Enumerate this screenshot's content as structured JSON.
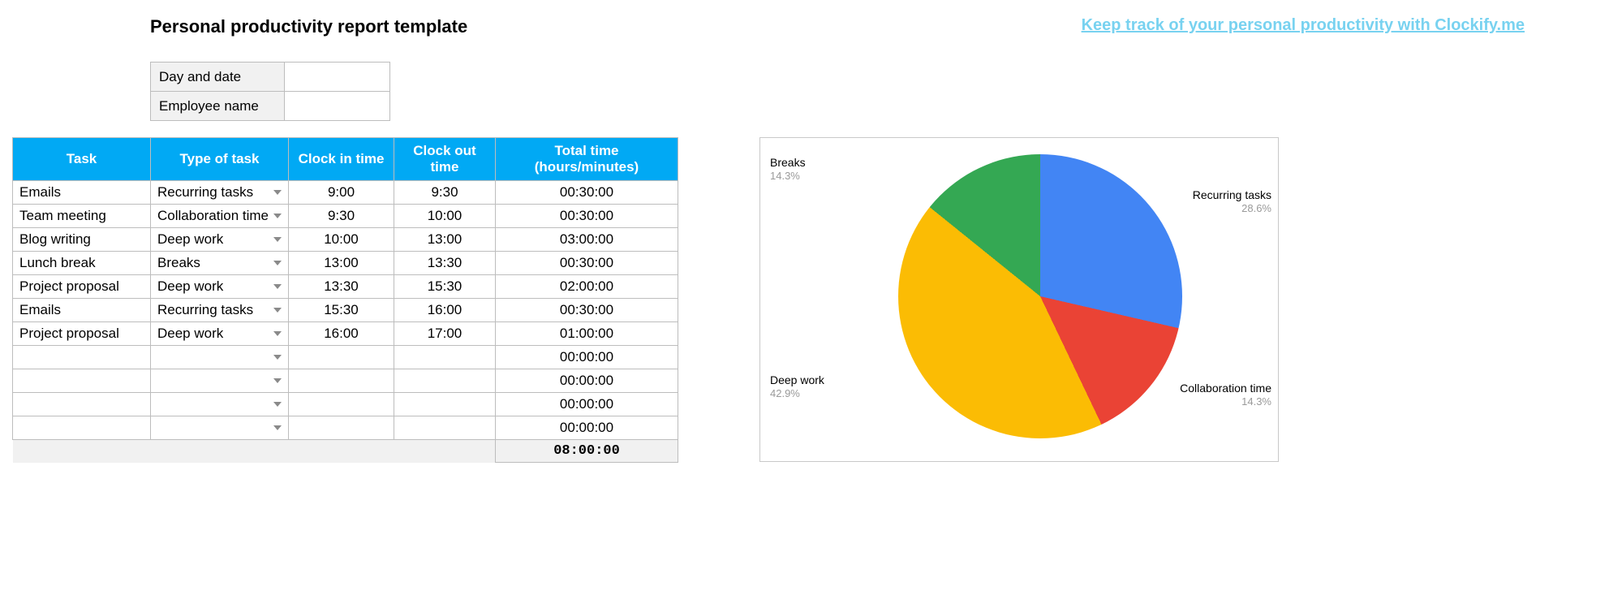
{
  "header": {
    "title": "Personal productivity report template",
    "promo_link": "Keep track of your personal productivity with Clockify.me"
  },
  "meta": {
    "day_date_label": "Day and date",
    "day_date_value": "",
    "employee_label": "Employee name",
    "employee_value": ""
  },
  "table": {
    "columns": {
      "task": "Task",
      "type": "Type of task",
      "clock_in": "Clock in time",
      "clock_out": "Clock out time",
      "total": "Total time (hours/minutes)"
    },
    "rows": [
      {
        "task": "Emails",
        "type": "Recurring tasks",
        "in": "9:00",
        "out": "9:30",
        "total": "00:30:00"
      },
      {
        "task": "Team meeting",
        "type": "Collaboration time",
        "in": "9:30",
        "out": "10:00",
        "total": "00:30:00"
      },
      {
        "task": "Blog writing",
        "type": "Deep work",
        "in": "10:00",
        "out": "13:00",
        "total": "03:00:00"
      },
      {
        "task": "Lunch break",
        "type": "Breaks",
        "in": "13:00",
        "out": "13:30",
        "total": "00:30:00"
      },
      {
        "task": "Project proposal",
        "type": "Deep work",
        "in": "13:30",
        "out": "15:30",
        "total": "02:00:00"
      },
      {
        "task": "Emails",
        "type": "Recurring tasks",
        "in": "15:30",
        "out": "16:00",
        "total": "00:30:00"
      },
      {
        "task": "Project proposal",
        "type": "Deep work",
        "in": "16:00",
        "out": "17:00",
        "total": "01:00:00"
      },
      {
        "task": "",
        "type": "",
        "in": "",
        "out": "",
        "total": "00:00:00"
      },
      {
        "task": "",
        "type": "",
        "in": "",
        "out": "",
        "total": "00:00:00"
      },
      {
        "task": "",
        "type": "",
        "in": "",
        "out": "",
        "total": "00:00:00"
      },
      {
        "task": "",
        "type": "",
        "in": "",
        "out": "",
        "total": "00:00:00"
      }
    ],
    "grand_total": "08:00:00"
  },
  "chart_data": {
    "type": "pie",
    "title": "",
    "series": [
      {
        "name": "Recurring tasks",
        "value": 28.6,
        "color": "#4285F4"
      },
      {
        "name": "Collaboration time",
        "value": 14.3,
        "color": "#EA4335"
      },
      {
        "name": "Deep work",
        "value": 42.9,
        "color": "#FBBC04"
      },
      {
        "name": "Breaks",
        "value": 14.3,
        "color": "#34A853"
      }
    ],
    "unit": "%"
  },
  "chart_labels": {
    "breaks": {
      "name": "Breaks",
      "pct": "14.3%"
    },
    "recurr": {
      "name": "Recurring tasks",
      "pct": "28.6%"
    },
    "deep": {
      "name": "Deep work",
      "pct": "42.9%"
    },
    "collab": {
      "name": "Collaboration time",
      "pct": "14.3%"
    }
  }
}
